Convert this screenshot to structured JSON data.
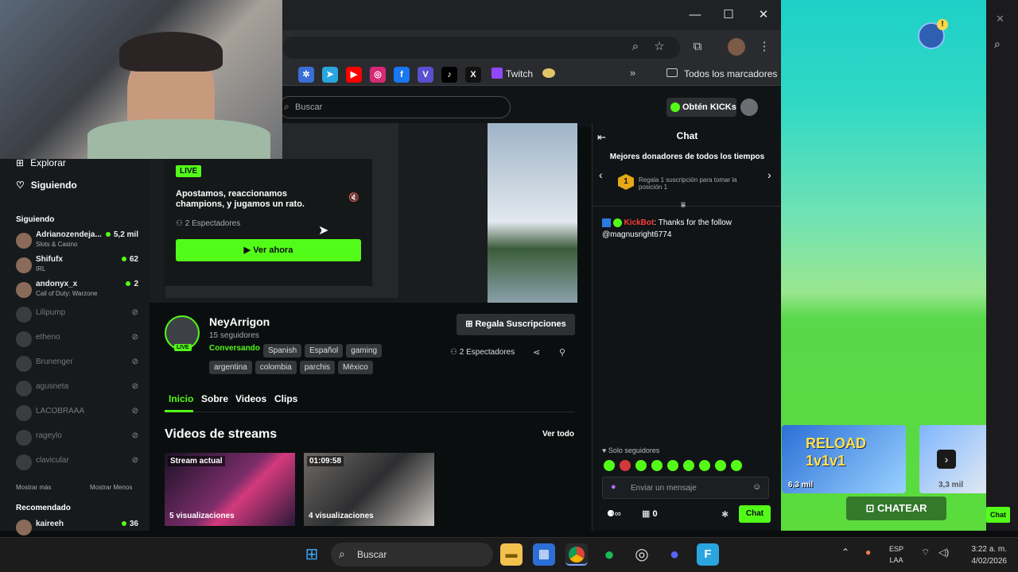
{
  "browser": {
    "bookmarks": [
      {
        "icon": "settings-icon",
        "color": "#3a6ed8",
        "glyph": "✲"
      },
      {
        "icon": "telegram-icon",
        "color": "#2aa5e0",
        "glyph": "➤"
      },
      {
        "icon": "youtube-icon",
        "color": "#ff0000",
        "glyph": "▶"
      },
      {
        "icon": "instagram-icon",
        "color": "#d62976",
        "glyph": "◎"
      },
      {
        "icon": "facebook-icon",
        "color": "#1877f2",
        "glyph": "f"
      },
      {
        "icon": "vimeo-icon",
        "color": "#5a4fcf",
        "glyph": "V"
      },
      {
        "icon": "tiktok-icon",
        "color": "#000000",
        "glyph": "♪"
      },
      {
        "icon": "x-icon",
        "color": "#111111",
        "glyph": "X"
      }
    ],
    "twitch_label": "Twitch",
    "all_bookmarks": "Todos los marcadores"
  },
  "topbar": {
    "search_placeholder": "Buscar",
    "kicks_button": "Obtén KICKs"
  },
  "sidebar": {
    "explore": "Explorar",
    "following_nav": "Siguiendo",
    "section_following": "Siguiendo",
    "channels": [
      {
        "name": "Adrianozendeja...",
        "category": "Slots & Casino",
        "viewers": "5,2 mil",
        "live": true
      },
      {
        "name": "Shifufx",
        "category": "IRL",
        "viewers": "62",
        "live": true
      },
      {
        "name": "andonyx_x",
        "category": "Call of Duty: Warzone",
        "viewers": "2",
        "live": true
      },
      {
        "name": "Lilipump",
        "category": "",
        "viewers": "",
        "live": false
      },
      {
        "name": "etheno",
        "category": "",
        "viewers": "",
        "live": false
      },
      {
        "name": "Brunenger",
        "category": "",
        "viewers": "",
        "live": false
      },
      {
        "name": "agusneta",
        "category": "",
        "viewers": "",
        "live": false
      },
      {
        "name": "LACOBRAAA",
        "category": "",
        "viewers": "",
        "live": false
      },
      {
        "name": "rageylo",
        "category": "",
        "viewers": "",
        "live": false
      },
      {
        "name": "clavicular",
        "category": "",
        "viewers": "",
        "live": false
      }
    ],
    "show_more": "Mostrar más",
    "show_less": "Mostrar Menos",
    "section_recommended": "Recomendado",
    "recommended": [
      {
        "name": "kaireeh",
        "viewers": "36"
      }
    ]
  },
  "player": {
    "live_badge": "LIVE",
    "stream_title": "Apostamos, reaccionamos champions, y jugamos un rato.",
    "viewers": "2 Espectadores",
    "watch_now": "Ver ahora"
  },
  "channel": {
    "name": "NeyArrigon",
    "followers": "15 seguidores",
    "live_badge": "LIVE",
    "category": "Conversando",
    "tags": [
      "Spanish",
      "Español",
      "gaming",
      "argentina",
      "colombia",
      "parchis",
      "México"
    ],
    "gift_subs": "Regala Suscripciones",
    "viewers": "2 Espectadores",
    "tabs": [
      "Inicio",
      "Sobre",
      "Videos",
      "Clips"
    ],
    "videos_heading": "Videos de streams",
    "see_all": "Ver todo",
    "videos": [
      {
        "badge": "Stream actual",
        "views": "5 visualizaciones"
      },
      {
        "badge": "01:09:58",
        "views": "4 visualizaciones"
      }
    ]
  },
  "chat": {
    "title": "Chat",
    "donors_heading": "Mejores donadores de todos los tiempos",
    "donor_rank": "1",
    "donor_text": "Regala 1 suscripción para tomar la posición 1",
    "msg_user": "KickBot",
    "msg_text": ": Thanks for the follow @magnusright6774",
    "followers_only": "Solo seguidores",
    "input_placeholder": "Enviar un mensaje",
    "count": "0",
    "send": "Chat"
  },
  "game": {
    "card1_title": "RELOAD 1v1v1",
    "card1_count": "6,3 mil",
    "card2_count": "3,3 mil",
    "chat_button": "CHATEAR",
    "side_chat": "Chat"
  },
  "taskbar": {
    "search": "Buscar",
    "lang_top": "ESP",
    "lang_bottom": "LAA",
    "time": "3:22 a. m.",
    "date": "4/02/2026"
  }
}
